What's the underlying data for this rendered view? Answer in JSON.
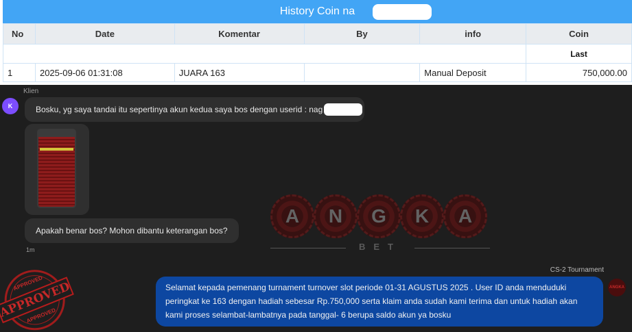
{
  "history": {
    "title": "History Coin na",
    "columns": [
      "No",
      "Date",
      "Komentar",
      "By",
      "info",
      "Coin"
    ],
    "subheader_last": "Last",
    "rows": [
      {
        "no": "1",
        "date": "2025-09-06 01:31:08",
        "komentar": "JUARA 163",
        "by": "",
        "info": "Manual Deposit",
        "coin": "750,000.00"
      }
    ]
  },
  "chat": {
    "sender_label": "Klien",
    "client_avatar_letter": "K",
    "messages_in": [
      "Bosku, yg saya tandai itu sepertinya akun kedua saya bos dengan userid : nag",
      "Apakah benar bos? Mohon dibantu keterangan bos?"
    ],
    "time_in": "1m",
    "agent_label": "CS-2 Tournament",
    "message_out": "Selamat kepada pemenang turnament turnover slot periode 01-31 AGUSTUS 2025 . User ID anda menduduki peringkat ke 163 dengan hadiah sebesar Rp.750,000 serta klaim anda sudah kami terima dan untuk hadiah akan kami proses selambat-lambatnya pada tanggal- 6 berupa saldo akun ya bosku"
  },
  "watermark": {
    "letters": [
      "A",
      "N",
      "G",
      "K",
      "A"
    ],
    "sub": "BET"
  },
  "stamp": {
    "main": "APPROVED",
    "small": "APPROVED"
  },
  "colors": {
    "header_blue": "#42a5f5",
    "coin_green": "#2e7d32",
    "out_bubble": "#0d47a1",
    "stamp_red": "#b71c1c"
  }
}
